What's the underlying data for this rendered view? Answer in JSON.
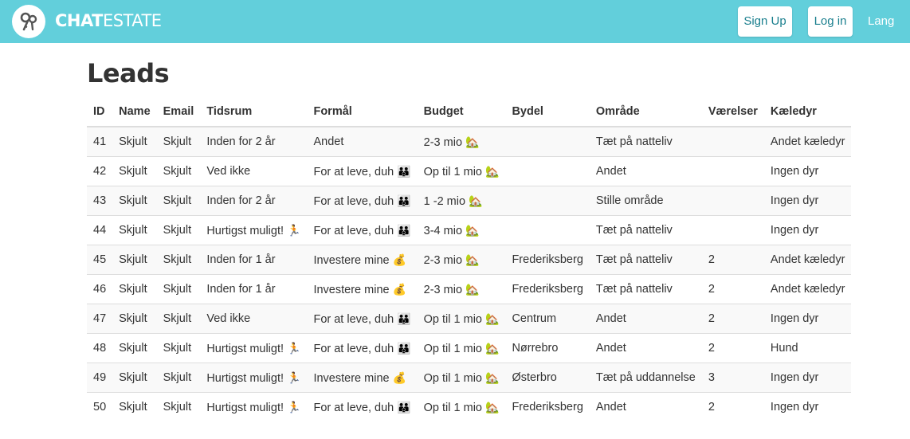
{
  "app": {
    "brand_bold": "CHAT",
    "brand_light": "ESTATE",
    "accent_color": "#62cfdb",
    "logo_icon": "keys-icon"
  },
  "nav": {
    "signup_label": "Sign Up",
    "login_label": "Log in",
    "lang_label": "Lang"
  },
  "page": {
    "title": "Leads"
  },
  "table": {
    "headers": {
      "id": "ID",
      "name": "Name",
      "email": "Email",
      "tidsrum": "Tidsrum",
      "formaal": "Formål",
      "budget": "Budget",
      "bydel": "Bydel",
      "omraade": "Område",
      "vaerelser": "Værelser",
      "kaeledyr": "Kæledyr"
    },
    "rows": [
      {
        "id": "41",
        "name": "Skjult",
        "email": "Skjult",
        "tidsrum": "Inden for 2 år",
        "tidsrum_emoji": "",
        "formaal": "Andet",
        "formaal_emoji": "",
        "budget": "2-3 mio",
        "budget_emoji": "🏡",
        "bydel": "",
        "omraade": "Tæt på natteliv",
        "vaerelser": "",
        "kaeledyr": "Andet kæledyr"
      },
      {
        "id": "42",
        "name": "Skjult",
        "email": "Skjult",
        "tidsrum": "Ved ikke",
        "tidsrum_emoji": "",
        "formaal": "For at leve, duh",
        "formaal_emoji": "👪",
        "budget": "Op til 1 mio",
        "budget_emoji": "🏡",
        "bydel": "",
        "omraade": "Andet",
        "vaerelser": "",
        "kaeledyr": "Ingen dyr"
      },
      {
        "id": "43",
        "name": "Skjult",
        "email": "Skjult",
        "tidsrum": "Inden for 2 år",
        "tidsrum_emoji": "",
        "formaal": "For at leve, duh",
        "formaal_emoji": "👪",
        "budget": "1 -2 mio",
        "budget_emoji": "🏡",
        "bydel": "",
        "omraade": "Stille område",
        "vaerelser": "",
        "kaeledyr": "Ingen dyr"
      },
      {
        "id": "44",
        "name": "Skjult",
        "email": "Skjult",
        "tidsrum": "Hurtigst muligt!",
        "tidsrum_emoji": "🏃",
        "formaal": "For at leve, duh",
        "formaal_emoji": "👪",
        "budget": "3-4 mio",
        "budget_emoji": "🏡",
        "bydel": "",
        "omraade": "Tæt på natteliv",
        "vaerelser": "",
        "kaeledyr": "Ingen dyr"
      },
      {
        "id": "45",
        "name": "Skjult",
        "email": "Skjult",
        "tidsrum": "Inden for 1 år",
        "tidsrum_emoji": "",
        "formaal": "Investere mine",
        "formaal_emoji": "💰",
        "budget": "2-3 mio",
        "budget_emoji": "🏡",
        "bydel": "Frederiksberg",
        "omraade": "Tæt på natteliv",
        "vaerelser": "2",
        "kaeledyr": "Andet kæledyr"
      },
      {
        "id": "46",
        "name": "Skjult",
        "email": "Skjult",
        "tidsrum": "Inden for 1 år",
        "tidsrum_emoji": "",
        "formaal": "Investere mine",
        "formaal_emoji": "💰",
        "budget": "2-3 mio",
        "budget_emoji": "🏡",
        "bydel": "Frederiksberg",
        "omraade": "Tæt på natteliv",
        "vaerelser": "2",
        "kaeledyr": "Andet kæledyr"
      },
      {
        "id": "47",
        "name": "Skjult",
        "email": "Skjult",
        "tidsrum": "Ved ikke",
        "tidsrum_emoji": "",
        "formaal": "For at leve, duh",
        "formaal_emoji": "👪",
        "budget": "Op til 1 mio",
        "budget_emoji": "🏡",
        "bydel": "Centrum",
        "omraade": "Andet",
        "vaerelser": "2",
        "kaeledyr": "Ingen dyr"
      },
      {
        "id": "48",
        "name": "Skjult",
        "email": "Skjult",
        "tidsrum": "Hurtigst muligt!",
        "tidsrum_emoji": "🏃",
        "formaal": "For at leve, duh",
        "formaal_emoji": "👪",
        "budget": "Op til 1 mio",
        "budget_emoji": "🏡",
        "bydel": "Nørrebro",
        "omraade": "Andet",
        "vaerelser": "2",
        "kaeledyr": "Hund"
      },
      {
        "id": "49",
        "name": "Skjult",
        "email": "Skjult",
        "tidsrum": "Hurtigst muligt!",
        "tidsrum_emoji": "🏃",
        "formaal": "Investere mine",
        "formaal_emoji": "💰",
        "budget": "Op til 1 mio",
        "budget_emoji": "🏡",
        "bydel": "Østerbro",
        "omraade": "Tæt på uddannelse",
        "vaerelser": "3",
        "kaeledyr": "Ingen dyr"
      },
      {
        "id": "50",
        "name": "Skjult",
        "email": "Skjult",
        "tidsrum": "Hurtigst muligt!",
        "tidsrum_emoji": "🏃",
        "formaal": "For at leve, duh",
        "formaal_emoji": "👪",
        "budget": "Op til 1 mio",
        "budget_emoji": "🏡",
        "bydel": "Frederiksberg",
        "omraade": "Andet",
        "vaerelser": "2",
        "kaeledyr": "Ingen dyr"
      }
    ]
  }
}
